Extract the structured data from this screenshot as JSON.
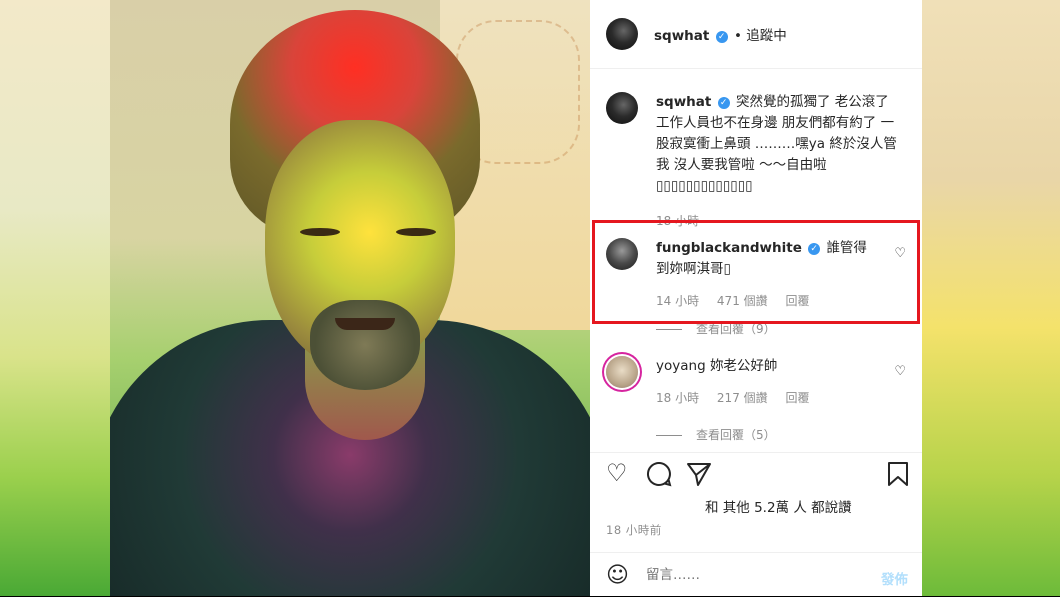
{
  "header": {
    "username": "sqwhat",
    "separator": "•",
    "follow_status": "追蹤中"
  },
  "caption": {
    "username": "sqwhat",
    "text": "突然覺的孤獨了 老公滾了 工作人員也不在身邊 朋友們都有約了 一股寂寞衝上鼻頭 ………嘿ya 終於沒人管我 沒人要我管啦 ～～自由啦▯▯▯▯▯▯▯▯▯▯▯▯▯",
    "time": "18 小時"
  },
  "comments": [
    {
      "username": "fungblackandwhite",
      "text": "誰管得到妳啊淇哥▯",
      "time": "14 小時",
      "likes": "471 個讚",
      "reply": "回覆",
      "view_replies": "查看回覆（9）"
    },
    {
      "username": "yoyang",
      "text": "妳老公好帥",
      "time": "18 小時",
      "likes": "217 個讚",
      "reply": "回覆",
      "view_replies": "查看回覆（5）"
    }
  ],
  "post": {
    "likes_text": "和 其他 5.2萬 人 都說讚",
    "time": "18 小時前"
  },
  "add_comment": {
    "placeholder": "留言……",
    "post_label": "發佈"
  },
  "colors": {
    "highlight": "#e5171f",
    "verified": "#3897f0",
    "post_disabled": "#b2dffc"
  },
  "icons": [
    "verified-icon",
    "heart-icon",
    "comment-icon",
    "share-icon",
    "bookmark-icon",
    "emoji-icon"
  ]
}
